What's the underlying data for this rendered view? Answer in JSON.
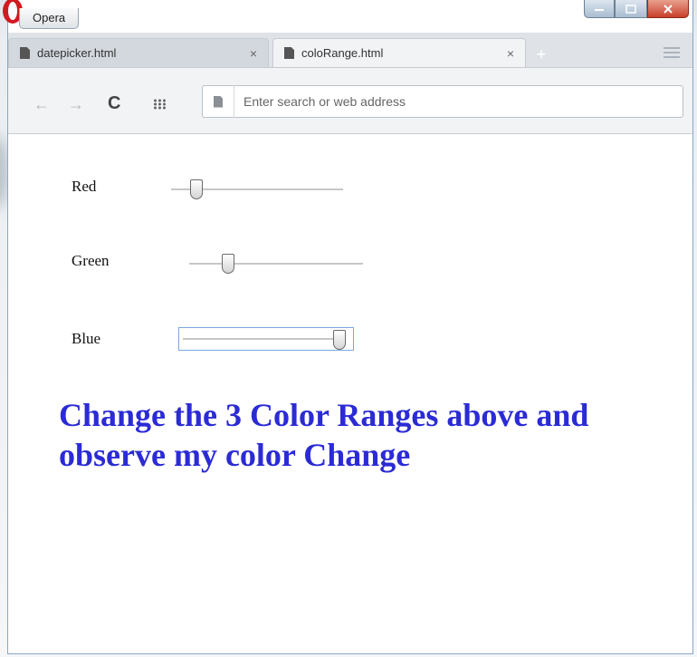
{
  "app": {
    "name": "Opera"
  },
  "tabs": [
    {
      "label": "datepicker.html",
      "close_icon": "×",
      "active": false
    },
    {
      "label": "coloRange.html",
      "close_icon": "×",
      "active": true
    }
  ],
  "toolbar": {
    "back_icon": "←",
    "forward_icon": "→",
    "reload_icon": "C",
    "address_placeholder": "Enter search or web address",
    "address_value": ""
  },
  "page": {
    "sliders": [
      {
        "label": "Red",
        "value_fraction": 0.12
      },
      {
        "label": "Green",
        "value_fraction": 0.2
      },
      {
        "label": "Blue",
        "value_fraction": 1.0
      }
    ],
    "headline": "Change the 3 Color Ranges above and observe my color Change"
  },
  "colors": {
    "headline": "#2b2bd6",
    "focus_border": "#7aa7e0",
    "opera_red": "#d11a1f",
    "close_button": "#c8412b"
  },
  "icons": [
    "opera-logo-icon",
    "page-icon",
    "close-icon",
    "new-tab-icon",
    "tab-menu-icon",
    "back-arrow-icon",
    "forward-arrow-icon",
    "reload-icon",
    "speed-dial-icon"
  ]
}
